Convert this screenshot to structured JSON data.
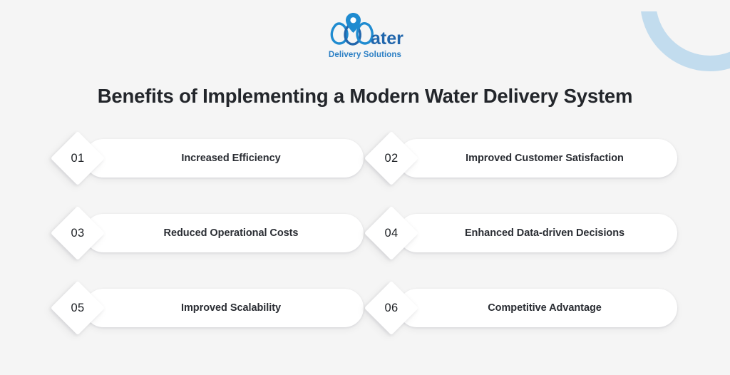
{
  "background_color": "#f5f5f5",
  "decoration": {
    "arc_name": "top-right-arc",
    "arc_color": "#c2dcee"
  },
  "logo": {
    "wordmark": "Water",
    "tagline": "Delivery Solutions",
    "pin_icon": "location-pin-icon",
    "brand_color": "#1f8bd0",
    "brand_color_dark": "#2166ac"
  },
  "header": {
    "title": "Benefits of Implementing a Modern Water Delivery System"
  },
  "benefits": [
    {
      "number": "01",
      "label": "Increased Efficiency"
    },
    {
      "number": "02",
      "label": "Improved Customer Satisfaction"
    },
    {
      "number": "03",
      "label": "Reduced Operational Costs"
    },
    {
      "number": "04",
      "label": "Enhanced Data-driven Decisions"
    },
    {
      "number": "05",
      "label": "Improved Scalability"
    },
    {
      "number": "06",
      "label": "Competitive Advantage"
    }
  ]
}
